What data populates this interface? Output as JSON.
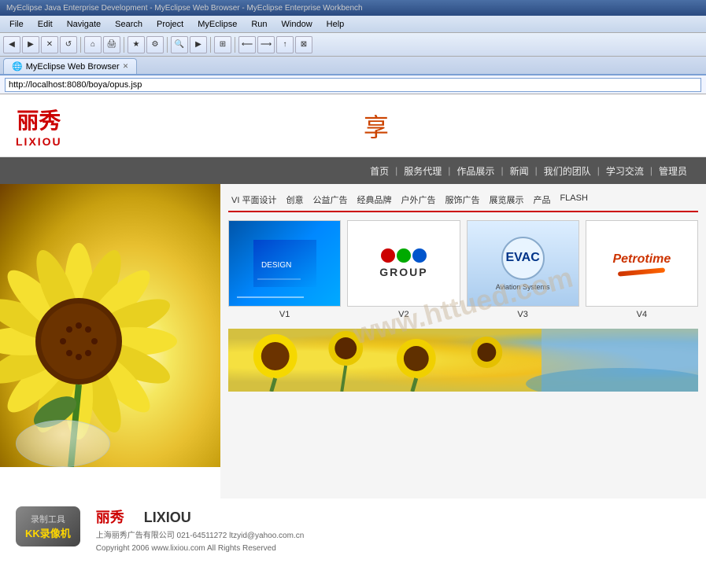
{
  "browser": {
    "titlebar": "MyEclipse Java Enterprise Development - MyEclipse Web Browser - MyEclipse Enterprise Workbench",
    "menus": [
      "File",
      "Edit",
      "Navigate",
      "Search",
      "Project",
      "MyEclipse",
      "Run",
      "Window",
      "Help"
    ],
    "tab_label": "MyEclipse Web Browser",
    "address": "http://localhost:8080/boya/opus.jsp"
  },
  "header": {
    "logo_chinese": "丽秀",
    "logo_english": "LIXIOU",
    "enjoy_char": "享"
  },
  "nav": {
    "items": [
      "首页",
      "服务代理",
      "作品展示",
      "新闻",
      "我们的团队",
      "学习交流",
      "管理员"
    ],
    "separator": "|"
  },
  "categories": {
    "items": [
      "VI 平面设计",
      "创意",
      "公益广告",
      "经典品牌",
      "户外广告",
      "服饰广告",
      "展览展示",
      "产品",
      "FLASH"
    ]
  },
  "portfolio": {
    "watermark": "www.httued.com",
    "items": [
      {
        "label": "V1",
        "type": "blue-design"
      },
      {
        "label": "V2",
        "type": "group-logo"
      },
      {
        "label": "V3",
        "type": "evac-logo"
      },
      {
        "label": "V4",
        "type": "petrotime"
      }
    ]
  },
  "footer": {
    "recorder_line1": "录制工具",
    "recorder_line2": "KK录像机",
    "brand_chinese": "丽秀",
    "brand_english": "LIXIOU",
    "company": "上海丽秀广告有限公司 021-64511272 ltzyid@yahoo.com.cn",
    "copyright": "Copyright 2006 www.lixiou.com All Rights Reserved"
  }
}
